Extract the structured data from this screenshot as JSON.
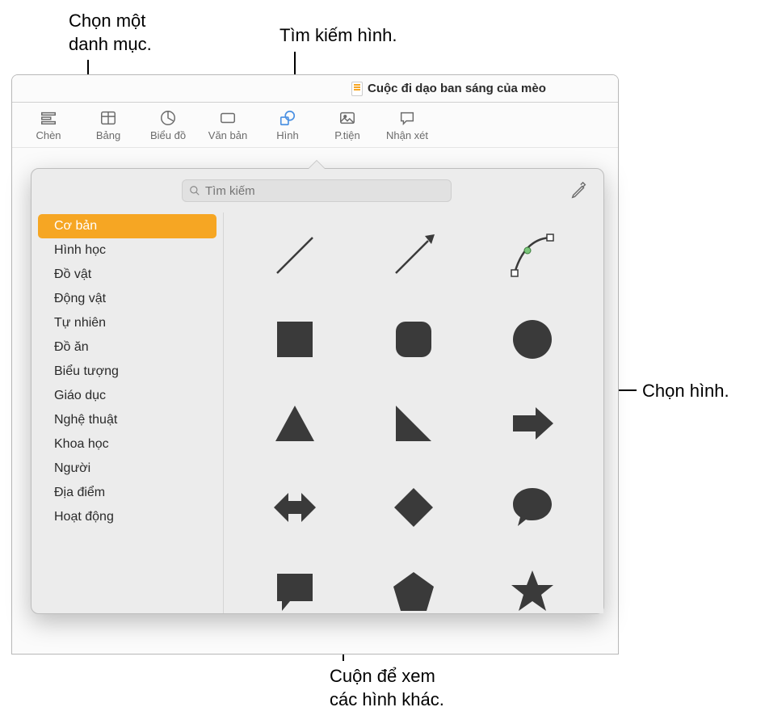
{
  "document_title": "Cuộc đi dạo ban sáng của mèo",
  "toolbar": {
    "insert": "Chèn",
    "table": "Bảng",
    "chart": "Biểu đồ",
    "text": "Văn bản",
    "shape": "Hình",
    "media": "P.tiện",
    "comment": "Nhận xét"
  },
  "search": {
    "placeholder": "Tìm kiếm"
  },
  "sidebar": {
    "items": [
      {
        "label": "Cơ bản",
        "selected": true
      },
      {
        "label": "Hình học"
      },
      {
        "label": "Đồ vật"
      },
      {
        "label": "Động vật"
      },
      {
        "label": "Tự nhiên"
      },
      {
        "label": "Đồ ăn"
      },
      {
        "label": "Biểu tượng"
      },
      {
        "label": "Giáo dục"
      },
      {
        "label": "Nghệ thuật"
      },
      {
        "label": "Khoa học"
      },
      {
        "label": "Người"
      },
      {
        "label": "Địa điểm"
      },
      {
        "label": "Hoạt động"
      }
    ]
  },
  "shapes": [
    "line",
    "arrow-line",
    "curve",
    "square",
    "rounded-square",
    "circle",
    "triangle",
    "right-triangle",
    "arrow-right",
    "double-arrow",
    "diamond",
    "speech-bubble",
    "speech-rect",
    "pentagon",
    "star"
  ],
  "callouts": {
    "category": "Chọn một\ndanh mục.",
    "search": "Tìm kiếm hình.",
    "choose": "Chọn hình.",
    "scroll": "Cuộn để xem\ncác hình khác."
  }
}
